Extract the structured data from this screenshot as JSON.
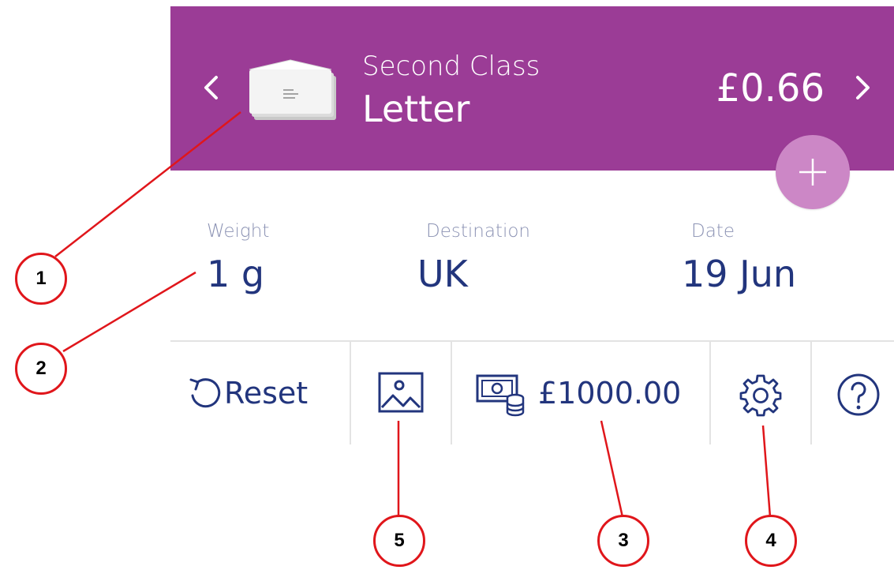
{
  "colors": {
    "brand": "#9b3c96",
    "add_button": "#cc87c6",
    "primary_text": "#22357d",
    "muted_text": "#8c93b4",
    "annotation": "#e0161b"
  },
  "header": {
    "prev_icon": "chevron-left-icon",
    "next_icon": "chevron-right-icon",
    "envelope_icon": "envelope-icon",
    "service_class": "Second Class",
    "service_name": "Letter",
    "price": "£0.66",
    "add_icon": "plus-icon"
  },
  "fields": [
    {
      "label": "Weight",
      "value": "1 g"
    },
    {
      "label": "Destination",
      "value": "UK"
    },
    {
      "label": "Date",
      "value": "19 Jun"
    }
  ],
  "toolbar": {
    "reset_label": "Reset",
    "reset_icon": "reset-icon",
    "image_icon": "image-icon",
    "balance_icon": "money-icon",
    "balance": "£1000.00",
    "settings_icon": "gear-icon",
    "help_icon": "help-icon"
  },
  "callouts": [
    "1",
    "2",
    "3",
    "4",
    "5"
  ]
}
